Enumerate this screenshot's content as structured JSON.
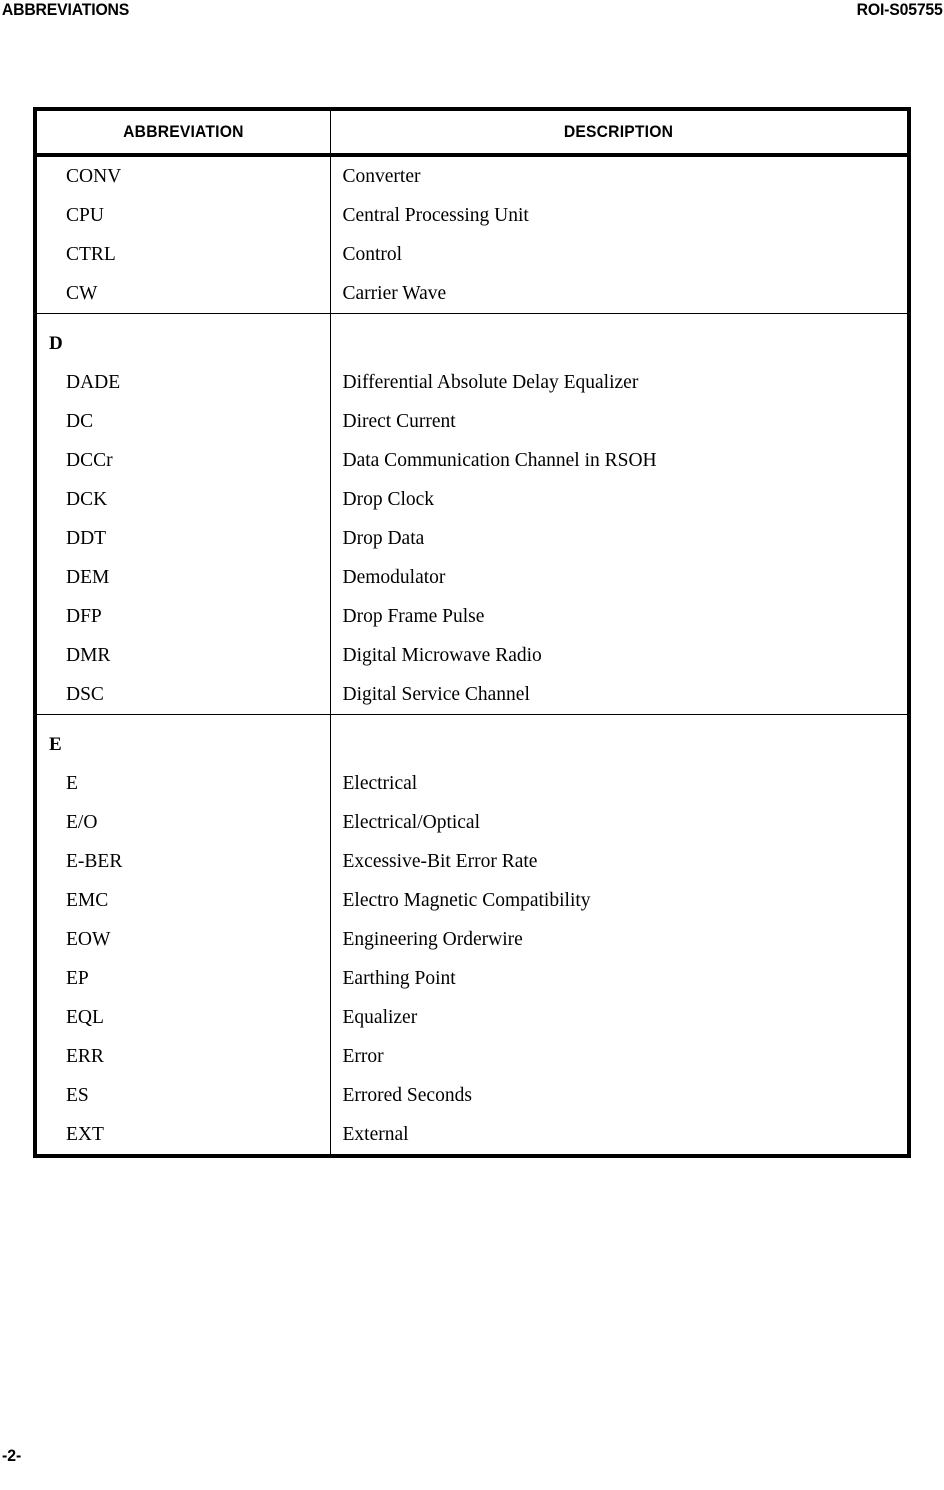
{
  "page": {
    "header_left": "ABBREVIATIONS",
    "header_right": "ROI-S05755",
    "folio": "-2-"
  },
  "table": {
    "columns": {
      "abbreviation": "ABBREVIATION",
      "description": "DESCRIPTION"
    },
    "rows": [
      {
        "type": "entry",
        "abbreviation": "CONV",
        "description": "Converter"
      },
      {
        "type": "entry",
        "abbreviation": "CPU",
        "description": "Central Processing Unit"
      },
      {
        "type": "entry",
        "abbreviation": "CTRL",
        "description": "Control"
      },
      {
        "type": "entry",
        "abbreviation": "CW",
        "description": "Carrier Wave"
      },
      {
        "type": "section",
        "abbreviation": "D",
        "description": ""
      },
      {
        "type": "entry",
        "abbreviation": "DADE",
        "description": "Differential Absolute Delay Equalizer"
      },
      {
        "type": "entry",
        "abbreviation": "DC",
        "description": "Direct Current"
      },
      {
        "type": "entry",
        "abbreviation": "DCCr",
        "description": "Data Communication Channel in RSOH"
      },
      {
        "type": "entry",
        "abbreviation": "DCK",
        "description": "Drop Clock"
      },
      {
        "type": "entry",
        "abbreviation": "DDT",
        "description": "Drop Data"
      },
      {
        "type": "entry",
        "abbreviation": "DEM",
        "description": "Demodulator"
      },
      {
        "type": "entry",
        "abbreviation": "DFP",
        "description": "Drop Frame Pulse"
      },
      {
        "type": "entry",
        "abbreviation": "DMR",
        "description": "Digital Microwave Radio"
      },
      {
        "type": "entry",
        "abbreviation": "DSC",
        "description": "Digital Service Channel"
      },
      {
        "type": "section",
        "abbreviation": "E",
        "description": ""
      },
      {
        "type": "entry",
        "abbreviation": "E",
        "description": "Electrical"
      },
      {
        "type": "entry",
        "abbreviation": "E/O",
        "description": "Electrical/Optical"
      },
      {
        "type": "entry",
        "abbreviation": "E-BER",
        "description": "Excessive-Bit Error Rate"
      },
      {
        "type": "entry",
        "abbreviation": "EMC",
        "description": "Electro Magnetic Compatibility"
      },
      {
        "type": "entry",
        "abbreviation": "EOW",
        "description": "Engineering Orderwire"
      },
      {
        "type": "entry",
        "abbreviation": "EP",
        "description": "Earthing Point"
      },
      {
        "type": "entry",
        "abbreviation": "EQL",
        "description": "Equalizer"
      },
      {
        "type": "entry",
        "abbreviation": "ERR",
        "description": "Error"
      },
      {
        "type": "entry",
        "abbreviation": "ES",
        "description": "Errored Seconds"
      },
      {
        "type": "entry",
        "abbreviation": "EXT",
        "description": "External"
      }
    ]
  }
}
